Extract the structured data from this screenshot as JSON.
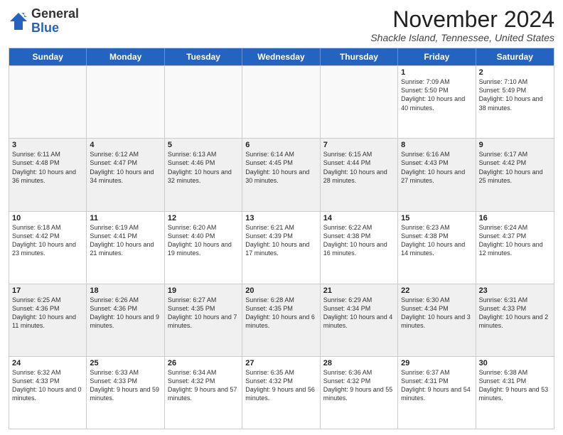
{
  "header": {
    "logo_general": "General",
    "logo_blue": "Blue",
    "month_year": "November 2024",
    "location": "Shackle Island, Tennessee, United States"
  },
  "calendar": {
    "days_of_week": [
      "Sunday",
      "Monday",
      "Tuesday",
      "Wednesday",
      "Thursday",
      "Friday",
      "Saturday"
    ],
    "rows": [
      [
        {
          "day": "",
          "info": ""
        },
        {
          "day": "",
          "info": ""
        },
        {
          "day": "",
          "info": ""
        },
        {
          "day": "",
          "info": ""
        },
        {
          "day": "",
          "info": ""
        },
        {
          "day": "1",
          "info": "Sunrise: 7:09 AM\nSunset: 5:50 PM\nDaylight: 10 hours and 40 minutes."
        },
        {
          "day": "2",
          "info": "Sunrise: 7:10 AM\nSunset: 5:49 PM\nDaylight: 10 hours and 38 minutes."
        }
      ],
      [
        {
          "day": "3",
          "info": "Sunrise: 6:11 AM\nSunset: 4:48 PM\nDaylight: 10 hours and 36 minutes."
        },
        {
          "day": "4",
          "info": "Sunrise: 6:12 AM\nSunset: 4:47 PM\nDaylight: 10 hours and 34 minutes."
        },
        {
          "day": "5",
          "info": "Sunrise: 6:13 AM\nSunset: 4:46 PM\nDaylight: 10 hours and 32 minutes."
        },
        {
          "day": "6",
          "info": "Sunrise: 6:14 AM\nSunset: 4:45 PM\nDaylight: 10 hours and 30 minutes."
        },
        {
          "day": "7",
          "info": "Sunrise: 6:15 AM\nSunset: 4:44 PM\nDaylight: 10 hours and 28 minutes."
        },
        {
          "day": "8",
          "info": "Sunrise: 6:16 AM\nSunset: 4:43 PM\nDaylight: 10 hours and 27 minutes."
        },
        {
          "day": "9",
          "info": "Sunrise: 6:17 AM\nSunset: 4:42 PM\nDaylight: 10 hours and 25 minutes."
        }
      ],
      [
        {
          "day": "10",
          "info": "Sunrise: 6:18 AM\nSunset: 4:42 PM\nDaylight: 10 hours and 23 minutes."
        },
        {
          "day": "11",
          "info": "Sunrise: 6:19 AM\nSunset: 4:41 PM\nDaylight: 10 hours and 21 minutes."
        },
        {
          "day": "12",
          "info": "Sunrise: 6:20 AM\nSunset: 4:40 PM\nDaylight: 10 hours and 19 minutes."
        },
        {
          "day": "13",
          "info": "Sunrise: 6:21 AM\nSunset: 4:39 PM\nDaylight: 10 hours and 17 minutes."
        },
        {
          "day": "14",
          "info": "Sunrise: 6:22 AM\nSunset: 4:38 PM\nDaylight: 10 hours and 16 minutes."
        },
        {
          "day": "15",
          "info": "Sunrise: 6:23 AM\nSunset: 4:38 PM\nDaylight: 10 hours and 14 minutes."
        },
        {
          "day": "16",
          "info": "Sunrise: 6:24 AM\nSunset: 4:37 PM\nDaylight: 10 hours and 12 minutes."
        }
      ],
      [
        {
          "day": "17",
          "info": "Sunrise: 6:25 AM\nSunset: 4:36 PM\nDaylight: 10 hours and 11 minutes."
        },
        {
          "day": "18",
          "info": "Sunrise: 6:26 AM\nSunset: 4:36 PM\nDaylight: 10 hours and 9 minutes."
        },
        {
          "day": "19",
          "info": "Sunrise: 6:27 AM\nSunset: 4:35 PM\nDaylight: 10 hours and 7 minutes."
        },
        {
          "day": "20",
          "info": "Sunrise: 6:28 AM\nSunset: 4:35 PM\nDaylight: 10 hours and 6 minutes."
        },
        {
          "day": "21",
          "info": "Sunrise: 6:29 AM\nSunset: 4:34 PM\nDaylight: 10 hours and 4 minutes."
        },
        {
          "day": "22",
          "info": "Sunrise: 6:30 AM\nSunset: 4:34 PM\nDaylight: 10 hours and 3 minutes."
        },
        {
          "day": "23",
          "info": "Sunrise: 6:31 AM\nSunset: 4:33 PM\nDaylight: 10 hours and 2 minutes."
        }
      ],
      [
        {
          "day": "24",
          "info": "Sunrise: 6:32 AM\nSunset: 4:33 PM\nDaylight: 10 hours and 0 minutes."
        },
        {
          "day": "25",
          "info": "Sunrise: 6:33 AM\nSunset: 4:33 PM\nDaylight: 9 hours and 59 minutes."
        },
        {
          "day": "26",
          "info": "Sunrise: 6:34 AM\nSunset: 4:32 PM\nDaylight: 9 hours and 57 minutes."
        },
        {
          "day": "27",
          "info": "Sunrise: 6:35 AM\nSunset: 4:32 PM\nDaylight: 9 hours and 56 minutes."
        },
        {
          "day": "28",
          "info": "Sunrise: 6:36 AM\nSunset: 4:32 PM\nDaylight: 9 hours and 55 minutes."
        },
        {
          "day": "29",
          "info": "Sunrise: 6:37 AM\nSunset: 4:31 PM\nDaylight: 9 hours and 54 minutes."
        },
        {
          "day": "30",
          "info": "Sunrise: 6:38 AM\nSunset: 4:31 PM\nDaylight: 9 hours and 53 minutes."
        }
      ]
    ]
  }
}
